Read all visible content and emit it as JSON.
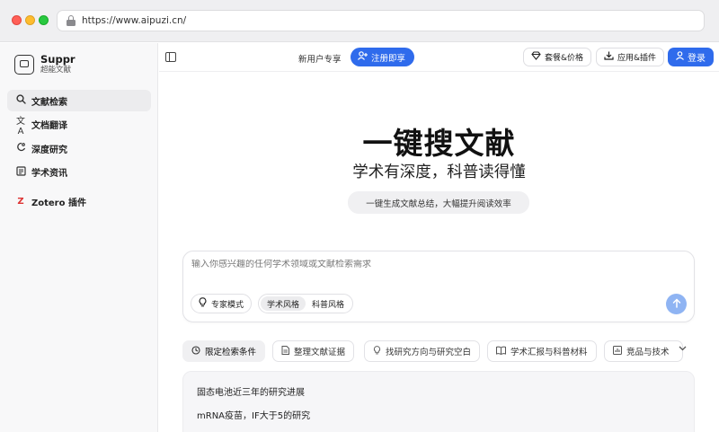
{
  "browser": {
    "url": "https://www.aipuzi.cn/"
  },
  "sidebar": {
    "brand_name": "Suppr",
    "brand_sub": "超能文献",
    "items": [
      {
        "label": "文献检索",
        "icon": "search-icon"
      },
      {
        "label": "文档翻译",
        "icon": "translate-icon"
      },
      {
        "label": "深度研究",
        "icon": "research-icon"
      },
      {
        "label": "学术资讯",
        "icon": "news-icon"
      },
      {
        "label": "Zotero 插件",
        "icon": "zotero-icon"
      }
    ]
  },
  "topbar": {
    "promo": "新用户专享",
    "register": "注册即享",
    "plans": "套餐&价格",
    "apps": "应用&插件",
    "login": "登录",
    "accent_color": "#2f6bec"
  },
  "hero": {
    "title": "一键搜文献",
    "subtitle": "学术有深度，科普读得懂",
    "chip": "一键生成文献总结，大幅提升阅读效率"
  },
  "search": {
    "placeholder": "输入你感兴趣的任何学术领域或文献检索需求",
    "expert_mode": "专家模式",
    "style_academic": "学术风格",
    "style_popular": "科普风格"
  },
  "tools": [
    {
      "label": "限定检索条件",
      "icon": "clock-icon"
    },
    {
      "label": "整理文献证据",
      "icon": "document-icon"
    },
    {
      "label": "找研究方向与研究空白",
      "icon": "lightbulb-icon"
    },
    {
      "label": "学术汇报与科普材料",
      "icon": "book-icon"
    },
    {
      "label": "竞品与技术",
      "icon": "chart-icon"
    }
  ],
  "suggestions": [
    "固态电池近三年的研究进展",
    "mRNA疫苗，IF大于5的研究"
  ]
}
